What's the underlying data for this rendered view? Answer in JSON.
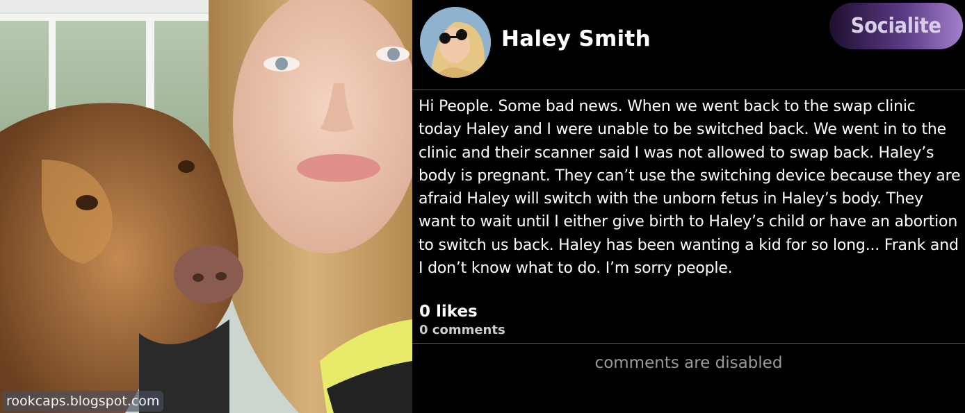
{
  "photo": {
    "alt_icon": "photo-of-woman-and-dog",
    "watermark": "rookcaps.blogspot.com"
  },
  "post": {
    "avatar_icon": "profile-avatar",
    "username": "Haley Smith",
    "brand": "Socialite",
    "body": "Hi People. Some bad news. When we went back to the swap clinic today Haley and I were unable to be switched back. We went in to the clinic and their scanner said I was not allowed to swap back. Haley’s body is pregnant. They can’t use the switching device because they are afraid Haley will switch with the unborn fetus in Haley’s body. They want to wait until I either give birth to Haley’s child or have an abortion to switch us back. Haley has been wanting a kid for so long... Frank and I don’t know what to do. I’m sorry people.",
    "likes": "0 likes",
    "comments": "0 comments",
    "comments_status": "comments are disabled"
  },
  "colors": {
    "background": "#000000",
    "text": "#ffffff",
    "muted": "#9a9a9a",
    "brand_gradient_start": "#1e0f2f",
    "brand_gradient_end": "#a37fcc"
  }
}
